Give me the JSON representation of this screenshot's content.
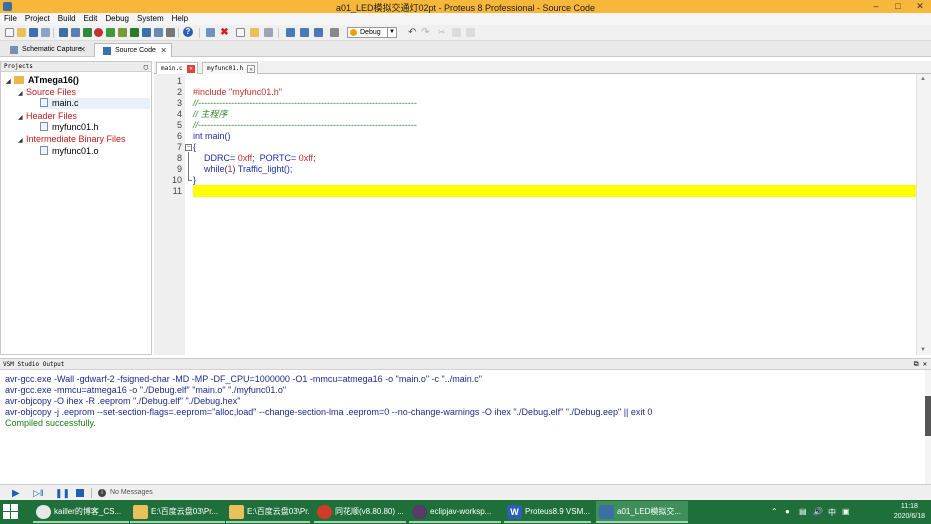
{
  "window": {
    "title": "a01_LED模拟交通灯02pt - Proteus 8 Professional - Source Code"
  },
  "menu": [
    "File",
    "Project",
    "Build",
    "Edit",
    "Debug",
    "System",
    "Help"
  ],
  "toolbar": {
    "build_config": "Debug"
  },
  "doc_tabs": [
    {
      "label": "Schematic Capture"
    },
    {
      "label": "Source Code"
    }
  ],
  "projects": {
    "header": "Projects",
    "root": "ATmega16()",
    "groups": [
      {
        "label": "Source Files",
        "files": [
          "main.c"
        ]
      },
      {
        "label": "Header Files",
        "files": [
          "myfunc01.h"
        ]
      },
      {
        "label": "Intermediate Binary Files",
        "files": [
          "myfunc01.o"
        ]
      }
    ]
  },
  "editor": {
    "tabs": [
      "main.c",
      "myfunc01.h"
    ],
    "line_numbers": [
      "1",
      "2",
      "3",
      "4",
      "5",
      "6",
      "7",
      "8",
      "9",
      "10",
      "11"
    ],
    "code": {
      "l2_pre": "#include ",
      "l2_str": "\"myfunc01.h\"",
      "l3": "//-------------------------------------------------------------------------",
      "l4": "// 主程序",
      "l5": "//-------------------------------------------------------------------------",
      "l6_kw": "int ",
      "l6_id": "main()",
      "l7": "{",
      "l8_a": "DDRC",
      "l8_b": "= ",
      "l8_c": "0xff",
      "l8_d": ";  PORTC",
      "l8_e": "= ",
      "l8_f": "0xff",
      "l8_g": ";",
      "l9_a": "while(",
      "l9_b": "1",
      "l9_c": ") Traffic_light();",
      "l10": "}"
    }
  },
  "output": {
    "header": "VSM Studio Output",
    "lines": [
      "avr-gcc.exe -Wall -gdwarf-2 -fsigned-char -MD -MP -DF_CPU=1000000 -O1 -mmcu=atmega16  -o \"main.o\" -c \"../main.c\"",
      "avr-gcc.exe -mmcu=atmega16  -o \"./Debug.elf\" \"main.o\" \"./myfunc01.o\"",
      "avr-objcopy -O ihex -R .eeprom \"./Debug.elf\" \"./Debug.hex\"",
      "avr-objcopy -j .eeprom --set-section-flags=.eeprom=\"alloc,load\" --change-section-lma .eeprom=0 --no-change-warnings -O ihex \"./Debug.elf\" \"./Debug.eep\" || exit 0",
      "Compiled successfully."
    ]
  },
  "status": {
    "messages": "No Messages"
  },
  "taskbar": {
    "tasks": [
      {
        "label": "kailler的博客_CS...",
        "icon": "chrome-icon"
      },
      {
        "label": "E:\\百度云盘03\\Pr...",
        "icon": "folder-icon"
      },
      {
        "label": "E:\\百度云盘03\\Pr...",
        "icon": "folder-icon"
      },
      {
        "label": "同花顺(v8.80.80) ...",
        "icon": "tonghuashun-icon"
      },
      {
        "label": "eclipjav-worksp...",
        "icon": "eclipse-icon"
      },
      {
        "label": "Proteus8.9 VSM...",
        "icon": "word-icon"
      },
      {
        "label": "a01_LED模拟交...",
        "icon": "proteus-icon"
      }
    ],
    "tray_lang": "中",
    "time": "11:18",
    "date": "2020/6/18"
  },
  "colors": {
    "title_bar": "#f6b73a",
    "taskbar": "#1f6f3a",
    "current_line": "#ffff00",
    "keyword": "#1a2fb0",
    "comment": "#2e8b2e",
    "string": "#c0302a",
    "success": "#178017"
  }
}
